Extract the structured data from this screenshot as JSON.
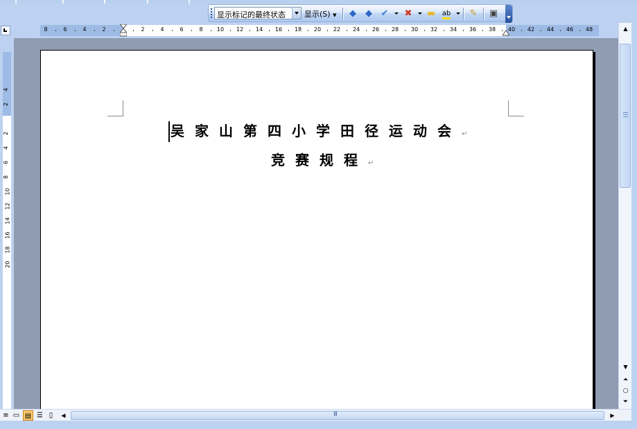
{
  "toolbar": {
    "markup_display": "显示标记的最终状态",
    "show_menu": "显示(S)",
    "icons": [
      "previous-change-icon",
      "next-change-icon",
      "accept-change-icon",
      "reject-change-icon",
      "new-comment-icon",
      "highlight-icon",
      "track-changes-icon",
      "reviewing-pane-icon"
    ]
  },
  "ruler": {
    "left_numbers": [
      "8",
      "6",
      "4",
      "2"
    ],
    "right_numbers": [
      "2",
      "4",
      "6",
      "8",
      "10",
      "12",
      "14",
      "16",
      "18",
      "20",
      "22",
      "24",
      "26",
      "28",
      "30",
      "32",
      "34",
      "36",
      "38",
      "40",
      "42",
      "44",
      "46",
      "48"
    ],
    "vertical_numbers": [
      "4",
      "2",
      "2",
      "4",
      "6",
      "8",
      "10",
      "12",
      "14",
      "16",
      "18",
      "20"
    ]
  },
  "document": {
    "title": "吴家山第四小学田径运动会",
    "subtitle": "竞赛规程",
    "paragraph_mark": "↵"
  },
  "scrollbar": {
    "thumb_grip": "III"
  }
}
